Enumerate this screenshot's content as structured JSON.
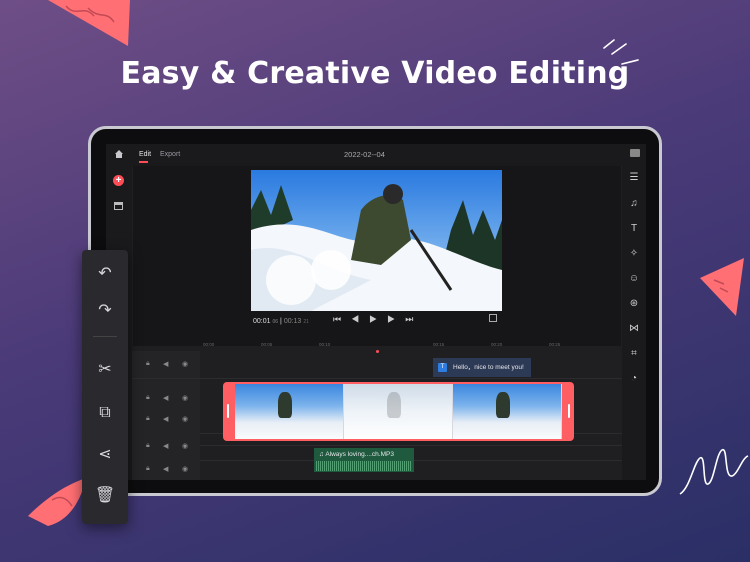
{
  "headline": "Easy & Creative Video Editing",
  "app": {
    "tabs": [
      {
        "label": "Edit"
      },
      {
        "label": "Export"
      }
    ],
    "project_date": "2022-02--04",
    "playback": {
      "current_time": "00:01",
      "current_frame": "06",
      "duration": "00:13",
      "duration_frame": "21"
    },
    "ruler_ticks": [
      "00:00",
      "00:05",
      "00:10",
      "00:15",
      "00:20",
      "00:25"
    ],
    "text_clip": "Hello，nice to meet you!",
    "text_clip_badge": "T",
    "audio_clip": "Always loving....ch.MP3"
  },
  "icons": {
    "left_column": [
      "home-icon",
      "add-icon",
      "archive-icon"
    ],
    "right_toolbar": [
      "layers-icon",
      "music-icon",
      "text-icon",
      "sticker-icon",
      "emoji-icon",
      "effects-icon",
      "transition-icon",
      "crop-icon",
      "speed-icon"
    ],
    "floating_toolbar": [
      "undo-icon",
      "redo-icon",
      "split-icon",
      "duplicate-icon",
      "share-icon",
      "delete-icon"
    ]
  },
  "colors": {
    "accent": "#ff5e62",
    "background_top": "#6f4e86",
    "background_bottom": "#2a2f66"
  }
}
